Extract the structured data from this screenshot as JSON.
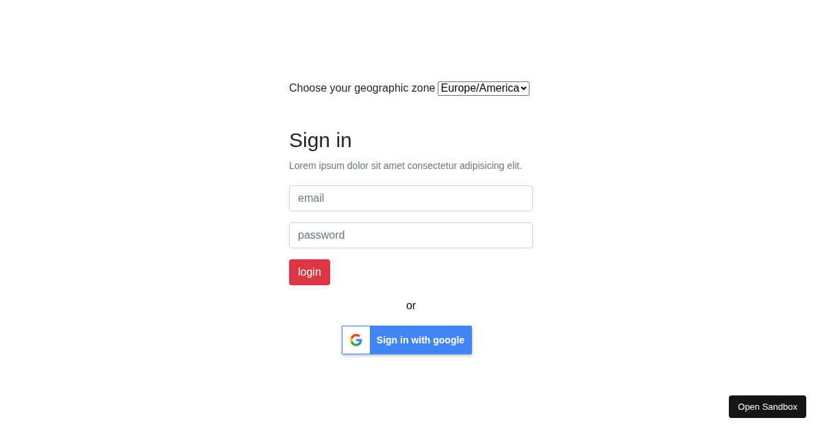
{
  "zone": {
    "label": "Choose your geographic zone",
    "value": "Europe/America"
  },
  "heading": "Sign in",
  "subtitle": "Lorem ipsum dolor sit amet consectetur adipisicing elit.",
  "fields": [
    {
      "placeholder": "email"
    },
    {
      "placeholder": "password"
    }
  ],
  "login_button": "login",
  "separator": "or",
  "google_button": "Sign in with google",
  "sandbox_button": "Open Sandbox"
}
